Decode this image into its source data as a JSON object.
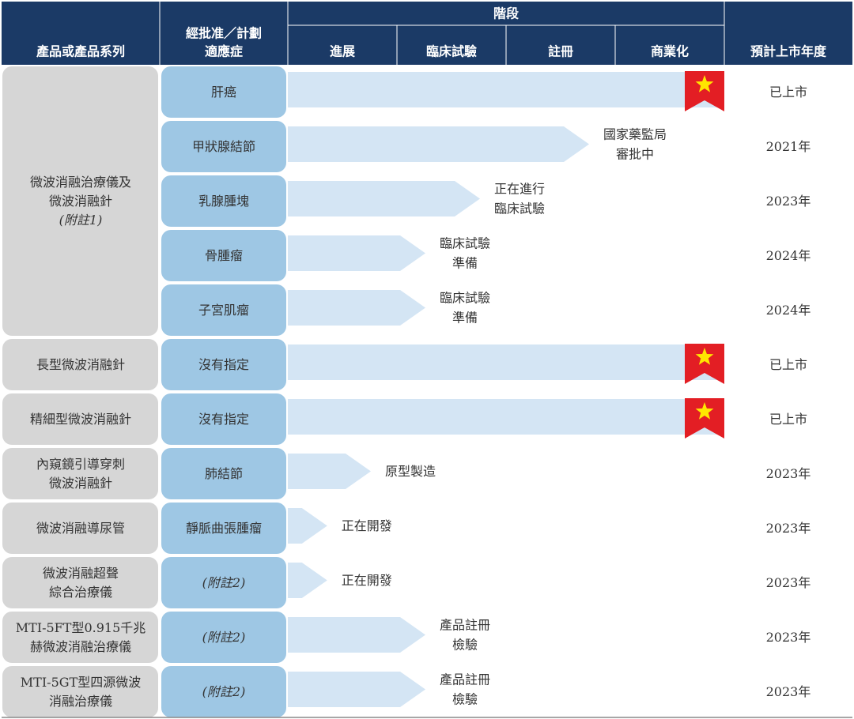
{
  "header": {
    "product_col": "產品或產品系列",
    "indication_col": [
      "經批准／計劃",
      "適應症"
    ],
    "stage_title": "階段",
    "stages": [
      "進展",
      "臨床試驗",
      "註冊",
      "商業化"
    ],
    "launch_col": "預計上市年度"
  },
  "products": [
    {
      "lines": [
        "微波消融治療儀及",
        "微波消融針",
        "(附註1)"
      ],
      "span": [
        0,
        4
      ]
    },
    {
      "lines": [
        "長型微波消融針"
      ],
      "span": [
        5,
        5
      ]
    },
    {
      "lines": [
        "精細型微波消融針"
      ],
      "span": [
        6,
        6
      ]
    },
    {
      "lines": [
        "內窺鏡引導穿刺",
        "微波消融針"
      ],
      "span": [
        7,
        7
      ]
    },
    {
      "lines": [
        "微波消融導尿管"
      ],
      "span": [
        8,
        8
      ]
    },
    {
      "lines": [
        "微波消融超聲",
        "綜合治療儀"
      ],
      "span": [
        9,
        9
      ]
    },
    {
      "lines": [
        "MTI-5FT型0.915千兆",
        "赫微波消融治療儀"
      ],
      "span": [
        10,
        10
      ]
    },
    {
      "lines": [
        "MTI-5GT型四源微波",
        "消融治療儀"
      ],
      "span": [
        11,
        11
      ]
    }
  ],
  "rows": [
    {
      "indication": "肝癌",
      "italic": false,
      "progress": 4.0,
      "launched": true,
      "status": [],
      "year": "已上市"
    },
    {
      "indication": "甲狀腺結節",
      "italic": false,
      "progress": 2.5,
      "launched": false,
      "status": [
        "國家藥監局",
        "審批中"
      ],
      "year": "2021年"
    },
    {
      "indication": "乳腺腫塊",
      "italic": false,
      "progress": 1.5,
      "launched": false,
      "status": [
        "正在進行",
        "臨床試驗"
      ],
      "year": "2023年"
    },
    {
      "indication": "骨腫瘤",
      "italic": false,
      "progress": 1.0,
      "launched": false,
      "status": [
        "臨床試驗",
        "準備"
      ],
      "year": "2024年"
    },
    {
      "indication": "子宮肌瘤",
      "italic": false,
      "progress": 1.0,
      "launched": false,
      "status": [
        "臨床試驗",
        "準備"
      ],
      "year": "2024年"
    },
    {
      "indication": "沒有指定",
      "italic": false,
      "progress": 4.0,
      "launched": true,
      "status": [],
      "year": "已上市"
    },
    {
      "indication": "沒有指定",
      "italic": false,
      "progress": 4.0,
      "launched": true,
      "status": [],
      "year": "已上市"
    },
    {
      "indication": "肺結節",
      "italic": false,
      "progress": 0.5,
      "launched": false,
      "status": [
        "原型製造"
      ],
      "year": "2023年"
    },
    {
      "indication": "靜脈曲張腫瘤",
      "italic": false,
      "progress": 0.1,
      "launched": false,
      "status": [
        "正在開發"
      ],
      "year": "2023年"
    },
    {
      "indication": "(附註2)",
      "italic": true,
      "progress": 0.1,
      "launched": false,
      "status": [
        "正在開發"
      ],
      "year": "2023年"
    },
    {
      "indication": "(附註2)",
      "italic": true,
      "progress": 1.0,
      "launched": false,
      "status": [
        "產品註冊",
        "檢驗"
      ],
      "year": "2023年"
    },
    {
      "indication": "(附註2)",
      "italic": true,
      "progress": 1.0,
      "launched": false,
      "status": [
        "產品註冊",
        "檢驗"
      ],
      "year": "2023年"
    }
  ],
  "colors": {
    "header_bg": "#1b3a66",
    "header_text": "#ffffff",
    "product_box": "#d6d6d6",
    "indication_box": "#9ec7e4",
    "progress_arrow": "#d4e5f4",
    "flag_red": "#e31e24",
    "star_yellow": "#ffe600",
    "text": "#333333",
    "rule": "#8a8a8a"
  },
  "icons": {
    "launched_marker": "star-flag-icon"
  }
}
